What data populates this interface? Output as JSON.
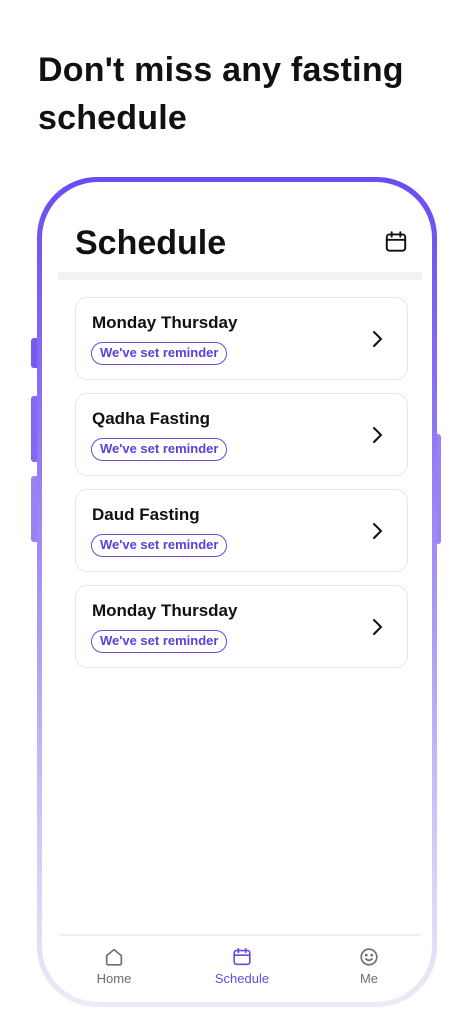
{
  "headline": "Don't miss any fasting schedule",
  "screen": {
    "title": "Schedule",
    "calendar_icon": "calendar-icon"
  },
  "schedules": [
    {
      "title": "Monday Thursday",
      "badge": "We've set reminder"
    },
    {
      "title": "Qadha Fasting",
      "badge": "We've set reminder"
    },
    {
      "title": "Daud Fasting",
      "badge": "We've set reminder"
    },
    {
      "title": "Monday Thursday",
      "badge": "We've set reminder"
    }
  ],
  "nav": {
    "home": {
      "label": "Home",
      "icon": "home-icon"
    },
    "schedule": {
      "label": "Schedule",
      "icon": "calendar-icon",
      "active": true
    },
    "me": {
      "label": "Me",
      "icon": "smiley-icon"
    }
  },
  "colors": {
    "accent": "#6a4bdc",
    "frame_top": "#6b4cf0",
    "frame_bottom": "#eeeaf7",
    "text": "#111111",
    "muted": "#6d6d75"
  }
}
